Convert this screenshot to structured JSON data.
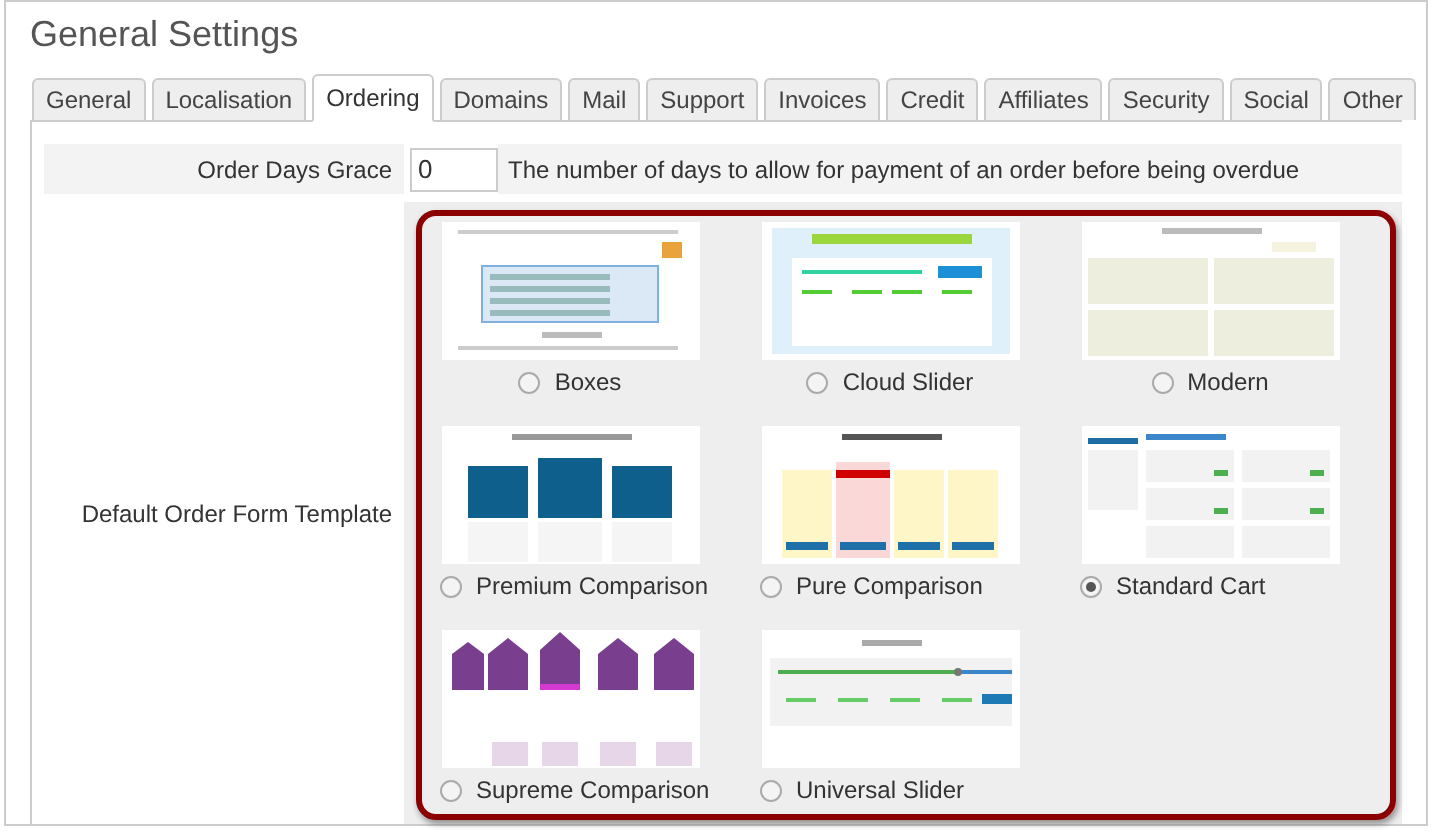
{
  "page_title": "General Settings",
  "tabs": [
    {
      "label": "General",
      "selected": false
    },
    {
      "label": "Localisation",
      "selected": false
    },
    {
      "label": "Ordering",
      "selected": true
    },
    {
      "label": "Domains",
      "selected": false
    },
    {
      "label": "Mail",
      "selected": false
    },
    {
      "label": "Support",
      "selected": false
    },
    {
      "label": "Invoices",
      "selected": false
    },
    {
      "label": "Credit",
      "selected": false
    },
    {
      "label": "Affiliates",
      "selected": false
    },
    {
      "label": "Security",
      "selected": false
    },
    {
      "label": "Social",
      "selected": false
    },
    {
      "label": "Other",
      "selected": false
    }
  ],
  "order_days_grace": {
    "label": "Order Days Grace",
    "value": "0",
    "description": "The number of days to allow for payment of an order before being overdue"
  },
  "order_form_template": {
    "label": "Default Order Form Template",
    "options": [
      {
        "label": "Boxes",
        "kind": "boxes",
        "selected": false
      },
      {
        "label": "Cloud Slider",
        "kind": "cloud",
        "selected": false
      },
      {
        "label": "Modern",
        "kind": "modern",
        "selected": false
      },
      {
        "label": "Premium Comparison",
        "kind": "premium",
        "selected": false
      },
      {
        "label": "Pure Comparison",
        "kind": "pure",
        "selected": false
      },
      {
        "label": "Standard Cart",
        "kind": "standard",
        "selected": true
      },
      {
        "label": "Supreme Comparison",
        "kind": "supreme",
        "selected": false
      },
      {
        "label": "Universal Slider",
        "kind": "universal",
        "selected": false
      }
    ]
  }
}
